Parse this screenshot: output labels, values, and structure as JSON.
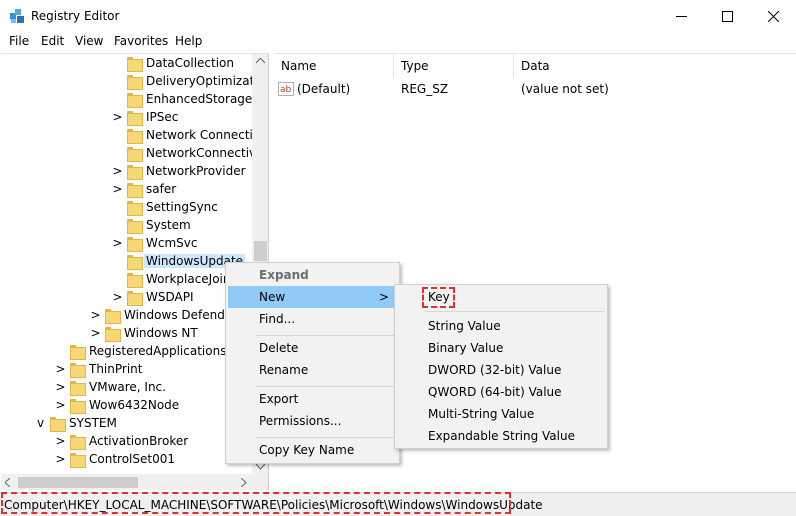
{
  "window": {
    "title": "Registry Editor",
    "minimize_glyph": "—",
    "maximize_glyph": "☐",
    "close_glyph": "✕"
  },
  "menu": {
    "items": [
      "File",
      "Edit",
      "View",
      "Favorites",
      "Help"
    ]
  },
  "tree": {
    "nodes": [
      {
        "label": "DataCollection",
        "chevron": ""
      },
      {
        "label": "DeliveryOptimizatio",
        "chevron": ""
      },
      {
        "label": "EnhancedStorageDe",
        "chevron": ""
      },
      {
        "label": "IPSec",
        "chevron": ">"
      },
      {
        "label": "Network Connectio",
        "chevron": ""
      },
      {
        "label": "NetworkConnectivi",
        "chevron": ""
      },
      {
        "label": "NetworkProvider",
        "chevron": ">"
      },
      {
        "label": "safer",
        "chevron": ">"
      },
      {
        "label": "SettingSync",
        "chevron": ""
      },
      {
        "label": "System",
        "chevron": ""
      },
      {
        "label": "WcmSvc",
        "chevron": ">"
      },
      {
        "label": "WindowsUpdate",
        "chevron": ""
      },
      {
        "label": "WorkplaceJoin",
        "chevron": ""
      },
      {
        "label": "WSDAPI",
        "chevron": ">"
      },
      {
        "label": "Windows Defende",
        "chevron": ">"
      },
      {
        "label": "Windows NT",
        "chevron": ">"
      },
      {
        "label": "RegisteredApplications",
        "chevron": ""
      },
      {
        "label": "ThinPrint",
        "chevron": ">"
      },
      {
        "label": "VMware, Inc.",
        "chevron": ">"
      },
      {
        "label": "Wow6432Node",
        "chevron": ">"
      },
      {
        "label": "SYSTEM",
        "chevron": "v"
      },
      {
        "label": "ActivationBroker",
        "chevron": ">"
      },
      {
        "label": "ControlSet001",
        "chevron": ">"
      }
    ]
  },
  "list": {
    "columns": [
      "Name",
      "Type",
      "Data"
    ],
    "rows": [
      {
        "name": "(Default)",
        "type": "REG_SZ",
        "data": "(value not set)",
        "icon": "string-value-icon"
      }
    ]
  },
  "context_menu": {
    "items": [
      {
        "label": "Expand",
        "disabled": true
      },
      {
        "label": "New",
        "highlighted": true,
        "submenu_arrow": ">"
      },
      {
        "label": "Find..."
      },
      {
        "label": "Delete"
      },
      {
        "label": "Rename"
      },
      {
        "label": "Export"
      },
      {
        "label": "Permissions..."
      },
      {
        "label": "Copy Key Name"
      }
    ]
  },
  "submenu": {
    "items": [
      "Key",
      "String Value",
      "Binary Value",
      "DWORD (32-bit) Value",
      "QWORD (64-bit) Value",
      "Multi-String Value",
      "Expandable String Value"
    ]
  },
  "statusbar": {
    "path": "Computer\\HKEY_LOCAL_MACHINE\\SOFTWARE\\Policies\\Microsoft\\Windows\\WindowsUpdate"
  },
  "colors": {
    "selection": "#cce8ff",
    "menu_highlight": "#91c9f7",
    "annotation": "#e0302f",
    "folder": "#f8d775"
  }
}
